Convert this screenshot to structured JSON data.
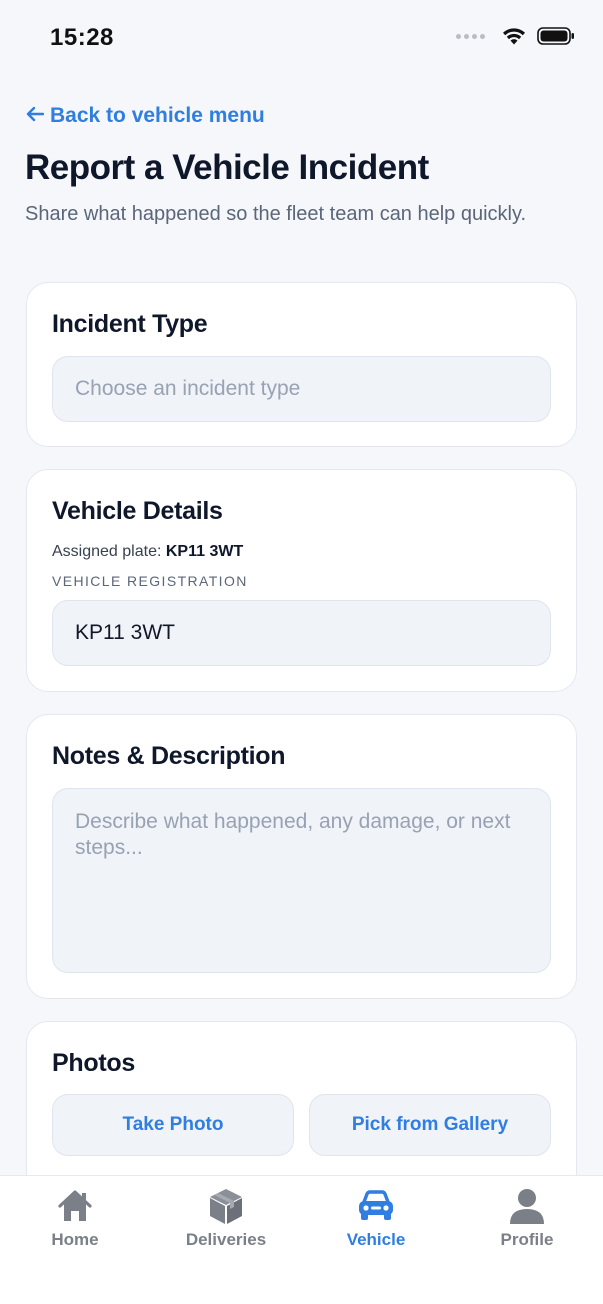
{
  "status_bar": {
    "time": "15:28"
  },
  "nav": {
    "back_label": "Back to vehicle menu"
  },
  "header": {
    "title": "Report a Vehicle Incident",
    "subtitle": "Share what happened so the fleet team can help quickly."
  },
  "incident_type": {
    "title": "Incident Type",
    "placeholder": "Choose an incident type"
  },
  "vehicle_details": {
    "title": "Vehicle Details",
    "assigned_prefix": "Assigned plate:",
    "assigned_plate": "KP11 3WT",
    "registration_label": "VEHICLE REGISTRATION",
    "registration_value": "KP11 3WT"
  },
  "notes": {
    "title": "Notes & Description",
    "placeholder": "Describe what happened, any damage, or next steps..."
  },
  "photos": {
    "title": "Photos",
    "take_photo_label": "Take Photo",
    "pick_gallery_label": "Pick from Gallery"
  },
  "tab_bar": {
    "items": [
      {
        "label": "Home",
        "icon": "home-icon",
        "active": false
      },
      {
        "label": "Deliveries",
        "icon": "package-icon",
        "active": false
      },
      {
        "label": "Vehicle",
        "icon": "car-icon",
        "active": true
      },
      {
        "label": "Profile",
        "icon": "person-icon",
        "active": false
      }
    ]
  },
  "colors": {
    "accent": "#2f7ee0",
    "background": "#f5f7fb",
    "inactive_tab": "#7a7f88"
  }
}
